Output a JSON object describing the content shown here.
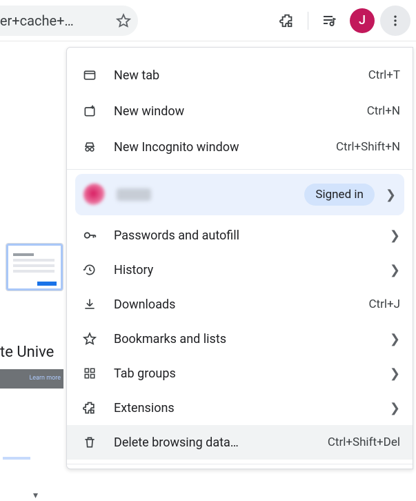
{
  "toolbar": {
    "omnibox_text": "+browser+cache+…",
    "avatar_initial": "J"
  },
  "background": {
    "truncated_text": "te Unive"
  },
  "menu": {
    "signed_in_label": "Signed in",
    "items": [
      {
        "label": "New tab",
        "shortcut": "Ctrl+T"
      },
      {
        "label": "New window",
        "shortcut": "Ctrl+N"
      },
      {
        "label": "New Incognito window",
        "shortcut": "Ctrl+Shift+N"
      },
      {
        "label": "Passwords and autofill"
      },
      {
        "label": "History"
      },
      {
        "label": "Downloads",
        "shortcut": "Ctrl+J"
      },
      {
        "label": "Bookmarks and lists"
      },
      {
        "label": "Tab groups"
      },
      {
        "label": "Extensions"
      },
      {
        "label": "Delete browsing data…",
        "shortcut": "Ctrl+Shift+Del"
      }
    ]
  }
}
